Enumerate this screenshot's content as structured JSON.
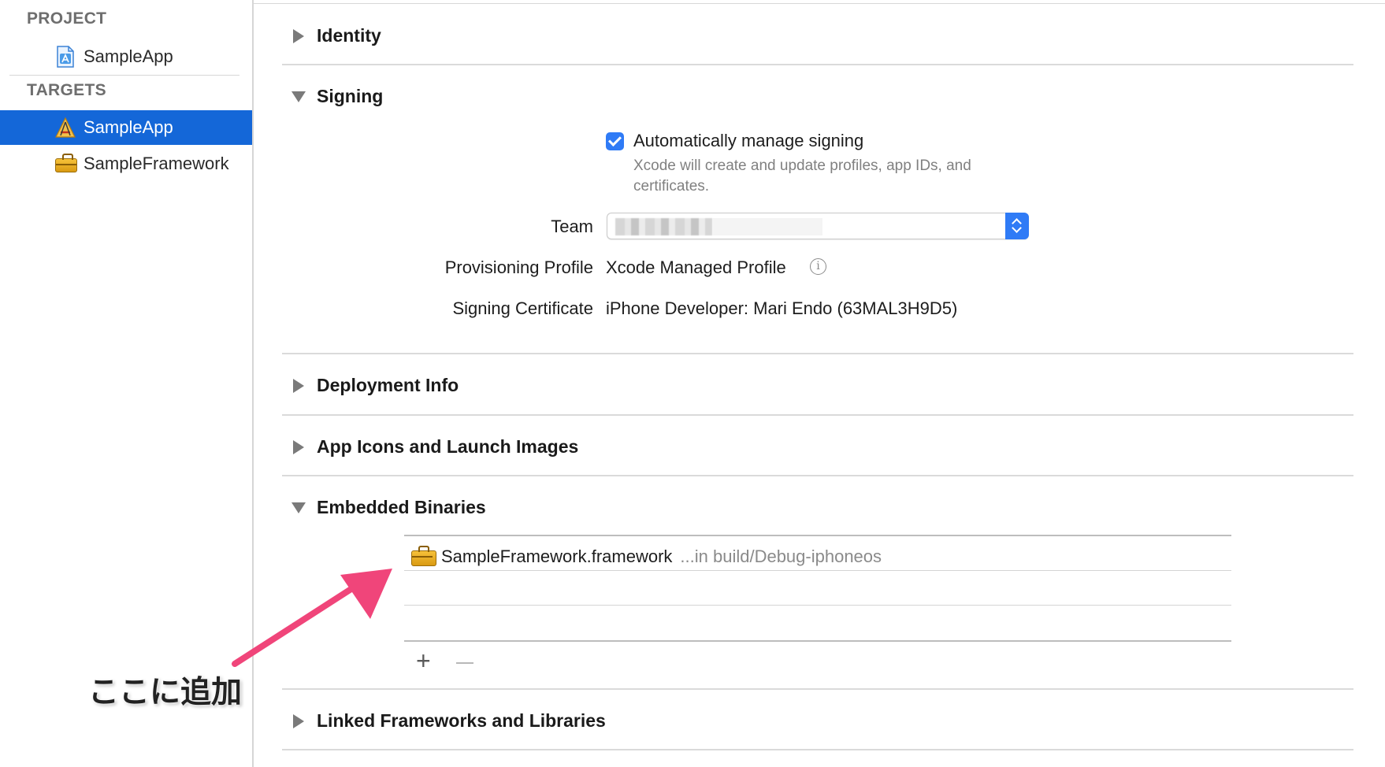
{
  "sidebar": {
    "project_header": "PROJECT",
    "project_item": "SampleApp",
    "targets_header": "TARGETS",
    "targets": [
      {
        "label": "SampleApp",
        "selected": true
      },
      {
        "label": "SampleFramework",
        "selected": false
      }
    ],
    "selection_color": "#1467d8"
  },
  "sections": {
    "identity": "Identity",
    "signing": "Signing",
    "deployment": "Deployment Info",
    "app_icons": "App Icons and Launch Images",
    "embedded": "Embedded Binaries",
    "linked": "Linked Frameworks and Libraries"
  },
  "signing": {
    "auto_manage_label": "Automatically manage signing",
    "auto_manage_checked": true,
    "auto_manage_desc": "Xcode will create and update profiles, app IDs, and certificates.",
    "team_label": "Team",
    "provisioning_label": "Provisioning Profile",
    "provisioning_value": "Xcode Managed Profile",
    "certificate_label": "Signing Certificate",
    "certificate_value": "iPhone Developer: Mari Endo (63MAL3H9D5)"
  },
  "embedded_binaries": {
    "rows": [
      {
        "name": "SampleFramework.framework",
        "path": "...in build/Debug-iphoneos"
      }
    ],
    "add_button": "+"
  },
  "annotation": {
    "text": "ここに追加",
    "arrow_color": "#f0457a"
  },
  "icons": [
    "app-project-icon",
    "app-target-icon",
    "toolbox-icon",
    "info-icon",
    "disclosure-triangle-icon"
  ]
}
